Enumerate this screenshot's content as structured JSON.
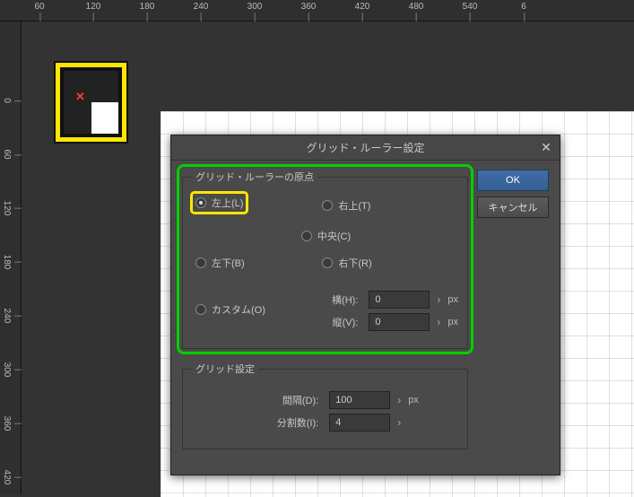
{
  "ruler": {
    "h": [
      "60",
      "",
      "120",
      "",
      "180",
      "",
      "240",
      "",
      "300",
      "",
      "360",
      "",
      "420",
      "",
      "480",
      "",
      "540",
      "",
      "6"
    ],
    "v": [
      "0",
      "",
      "60",
      "",
      "120",
      "",
      "180",
      "",
      "240",
      "",
      "300",
      "",
      "360",
      "",
      "420"
    ]
  },
  "dialog": {
    "title": "グリッド・ルーラー設定",
    "ok": "OK",
    "cancel": "キャンセル"
  },
  "origin": {
    "legend": "グリッド・ルーラーの原点",
    "topLeft": "左上(L)",
    "topRight": "右上(T)",
    "center": "中央(C)",
    "bottomLeft": "左下(B)",
    "bottomRight": "右下(R)",
    "custom": "カスタム(O)",
    "hLabel": "横(H):",
    "vLabel": "縦(V):",
    "hValue": "0",
    "vValue": "0",
    "unit": "px"
  },
  "gridSettings": {
    "legend": "グリッド設定",
    "intervalLabel": "間隔(D):",
    "intervalValue": "100",
    "intervalUnit": "px",
    "divisionsLabel": "分割数(I):",
    "divisionsValue": "4"
  },
  "markers": {
    "x": "✕"
  }
}
